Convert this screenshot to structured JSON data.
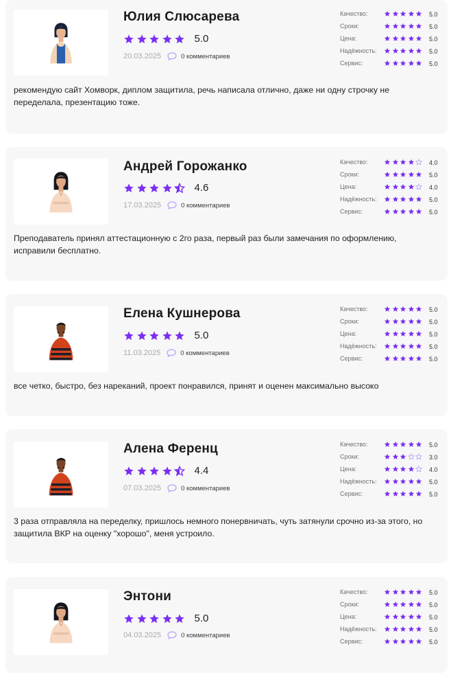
{
  "colors": {
    "accent": "#7b2ff2",
    "card_bg": "#f7f7f7",
    "star_empty": "#b9a4f5"
  },
  "criteria": [
    "Качество:",
    "Сроки:",
    "Цена:",
    "Надёжность:",
    "Сервис:"
  ],
  "comments_label": "0 комментариев",
  "reviews": [
    {
      "name": "Юлия Слюсарева",
      "avatar": "avatar-woman-blue-top",
      "rating": "5.0",
      "stars": 5,
      "date": "20.03.2025",
      "scores": [
        {
          "label": "Качество:",
          "value": "5.0",
          "stars": 5
        },
        {
          "label": "Сроки:",
          "value": "5.0",
          "stars": 5
        },
        {
          "label": "Цена:",
          "value": "5.0",
          "stars": 5
        },
        {
          "label": "Надёжность:",
          "value": "5.0",
          "stars": 5
        },
        {
          "label": "Сервис:",
          "value": "5.0",
          "stars": 5
        }
      ],
      "text": "рекомендую сайт Хомворк, диплом защитила, речь написала отлично, даже ни одну строчку не переделала, презентацию тоже."
    },
    {
      "name": "Андрей Горожанко",
      "avatar": "avatar-woman-beige",
      "rating": "4.6",
      "stars": 4.5,
      "date": "17.03.2025",
      "scores": [
        {
          "label": "Качество:",
          "value": "4.0",
          "stars": 4
        },
        {
          "label": "Сроки:",
          "value": "5.0",
          "stars": 5
        },
        {
          "label": "Цена:",
          "value": "4.0",
          "stars": 4
        },
        {
          "label": "Надёжность:",
          "value": "5.0",
          "stars": 5
        },
        {
          "label": "Сервис:",
          "value": "5.0",
          "stars": 5
        }
      ],
      "text": "Преподаватель принял аттестационную с 2го раза, первый раз были замечания по оформлению, исправили бесплатно."
    },
    {
      "name": "Елена Кушнерова",
      "avatar": "avatar-man-striped-sweater",
      "rating": "5.0",
      "stars": 5,
      "date": "11.03.2025",
      "scores": [
        {
          "label": "Качество:",
          "value": "5.0",
          "stars": 5
        },
        {
          "label": "Сроки:",
          "value": "5.0",
          "stars": 5
        },
        {
          "label": "Цена:",
          "value": "5.0",
          "stars": 5
        },
        {
          "label": "Надёжность:",
          "value": "5.0",
          "stars": 5
        },
        {
          "label": "Сервис:",
          "value": "5.0",
          "stars": 5
        }
      ],
      "text": "все четко, быстро, без нареканий, проект понравился, принят и оценен максимально высоко"
    },
    {
      "name": "Алена Ференц",
      "avatar": "avatar-man-striped-sweater",
      "rating": "4.4",
      "stars": 4.5,
      "date": "07.03.2025",
      "scores": [
        {
          "label": "Качество:",
          "value": "5.0",
          "stars": 5
        },
        {
          "label": "Сроки:",
          "value": "3.0",
          "stars": 3
        },
        {
          "label": "Цена:",
          "value": "4.0",
          "stars": 4
        },
        {
          "label": "Надёжность:",
          "value": "5.0",
          "stars": 5
        },
        {
          "label": "Сервис:",
          "value": "5.0",
          "stars": 5
        }
      ],
      "text": "3 раза отправляла на переделку, пришлось немного понервничать, чуть затянули срочно из-за этого, но защитила ВКР на оценку \"хорошо\", меня устроило."
    },
    {
      "name": "Энтони",
      "avatar": "avatar-woman-beige",
      "rating": "5.0",
      "stars": 5,
      "date": "04.03.2025",
      "scores": [
        {
          "label": "Качество:",
          "value": "5.0",
          "stars": 5
        },
        {
          "label": "Сроки:",
          "value": "5.0",
          "stars": 5
        },
        {
          "label": "Цена:",
          "value": "5.0",
          "stars": 5
        },
        {
          "label": "Надёжность:",
          "value": "5.0",
          "stars": 5
        },
        {
          "label": "Сервис:",
          "value": "5.0",
          "stars": 5
        }
      ],
      "text": ""
    }
  ]
}
